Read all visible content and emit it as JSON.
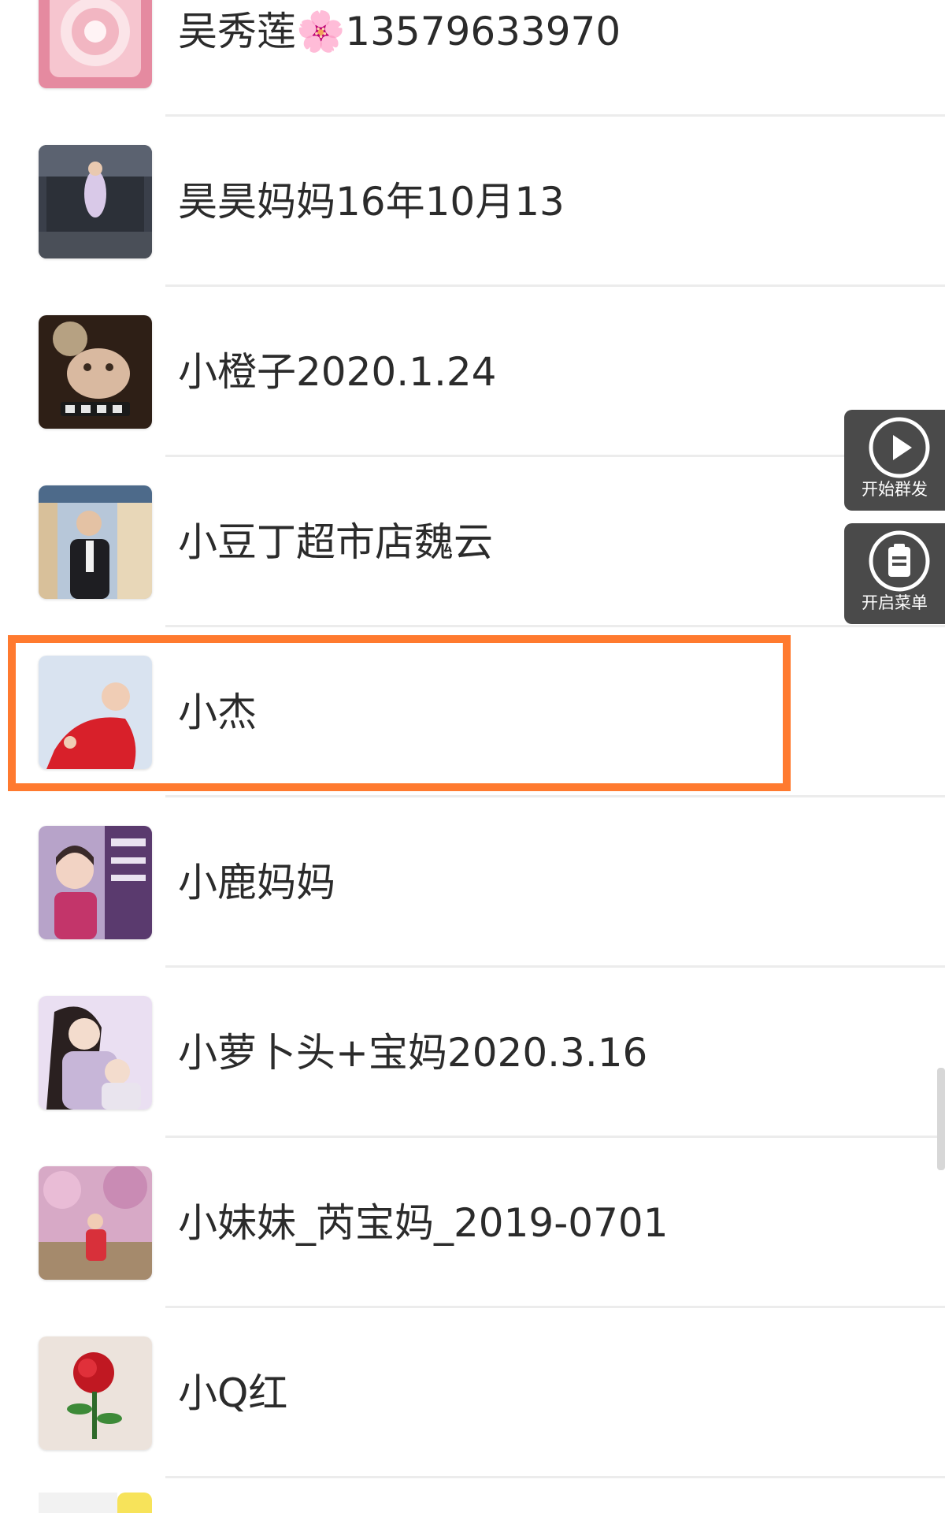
{
  "contacts": [
    {
      "name": "吴秀莲🌸13579633970",
      "avatar": "flower-card-avatar"
    },
    {
      "name": "昊昊妈妈16年10月13",
      "avatar": "stage-performer-avatar"
    },
    {
      "name": "小橙子2020.1.24",
      "avatar": "cat-photo-avatar"
    },
    {
      "name": "小豆丁超市店魏云",
      "avatar": "man-in-shop-avatar"
    },
    {
      "name": "小杰",
      "avatar": "baby-in-red-avatar"
    },
    {
      "name": "小鹿妈妈",
      "avatar": "child-with-banner-avatar"
    },
    {
      "name": "小萝卜头+宝妈2020.3.16",
      "avatar": "woman-with-baby-avatar"
    },
    {
      "name": "小妹妹_芮宝妈_2019-0701",
      "avatar": "pink-blossom-avatar"
    },
    {
      "name": "小Q红",
      "avatar": "red-rose-avatar"
    }
  ],
  "float_buttons": {
    "start": {
      "label": "开始群发",
      "icon": "play-icon"
    },
    "menu": {
      "label": "开启菜单",
      "icon": "clipboard-icon"
    }
  },
  "highlight": {
    "contact": "小杰",
    "color": "#ff7a2f"
  }
}
